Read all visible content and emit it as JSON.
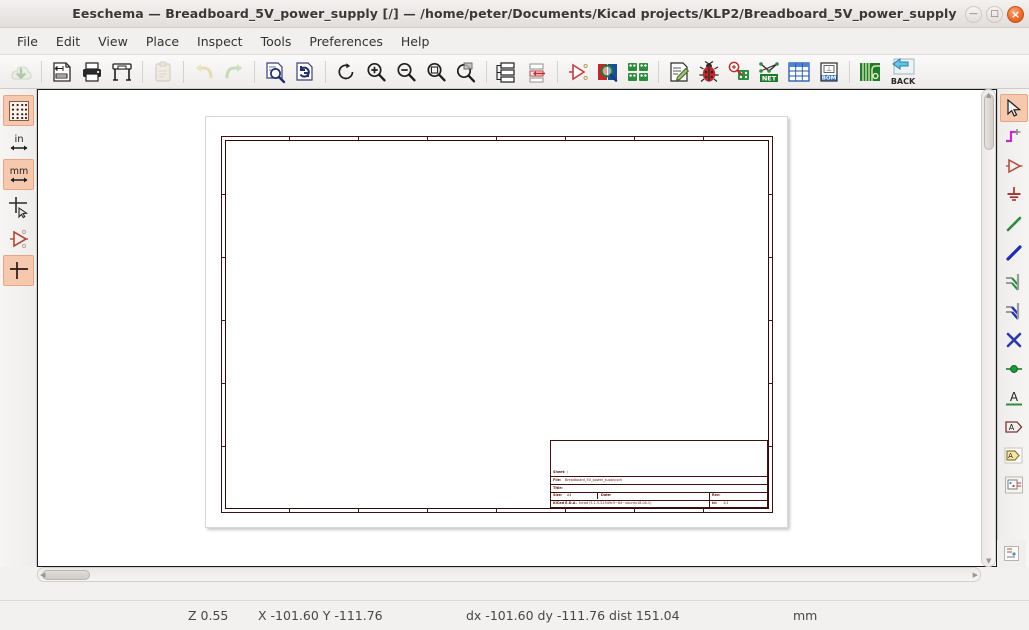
{
  "window": {
    "title": "Eeschema — Breadboard_5V_power_supply [/] — /home/peter/Documents/Kicad projects/KLP2/Breadboard_5V_power_supply",
    "minimize_label": "—",
    "maximize_label": "□",
    "close_label": "×"
  },
  "menubar": {
    "items": [
      {
        "label": "File"
      },
      {
        "label": "Edit"
      },
      {
        "label": "View"
      },
      {
        "label": "Place"
      },
      {
        "label": "Inspect"
      },
      {
        "label": "Tools"
      },
      {
        "label": "Preferences"
      },
      {
        "label": "Help"
      }
    ]
  },
  "toolbar": {
    "items": [
      {
        "name": "save-icon",
        "tip": "Save"
      },
      {
        "name": "page-settings-icon",
        "tip": "Page settings"
      },
      {
        "name": "print-icon",
        "tip": "Print"
      },
      {
        "name": "plot-icon",
        "tip": "Plot"
      },
      {
        "name": "paste-icon",
        "tip": "Paste"
      },
      {
        "name": "undo-icon",
        "tip": "Undo"
      },
      {
        "name": "redo-icon",
        "tip": "Redo"
      },
      {
        "name": "find-icon",
        "tip": "Find"
      },
      {
        "name": "refresh-icon",
        "tip": "Refresh"
      },
      {
        "name": "zoom-redraw-icon",
        "tip": "Redraw view"
      },
      {
        "name": "zoom-in-icon",
        "tip": "Zoom in"
      },
      {
        "name": "zoom-out-icon",
        "tip": "Zoom out"
      },
      {
        "name": "zoom-fit-icon",
        "tip": "Zoom to fit"
      },
      {
        "name": "zoom-area-icon",
        "tip": "Zoom to selection"
      },
      {
        "name": "navigate-hierarchy-icon",
        "tip": "Navigate schematic hierarchy"
      },
      {
        "name": "leave-sheet-icon",
        "tip": "Leave sheet"
      },
      {
        "name": "annotate-icon",
        "tip": "Annotate schematic symbols"
      },
      {
        "name": "symbol-checker-icon",
        "tip": "Symbol checker"
      },
      {
        "name": "symbol-editor-icon",
        "tip": "Symbol editor"
      },
      {
        "name": "erc-icon",
        "tip": "Electrical rules checker"
      },
      {
        "name": "footprint-assign-icon",
        "tip": "Assign footprints"
      },
      {
        "name": "netlist-icon",
        "tip": "Generate netlist"
      },
      {
        "name": "bom-table-icon",
        "tip": "Edit symbol fields"
      },
      {
        "name": "bom-icon",
        "tip": "Generate bill of materials"
      },
      {
        "name": "pcbnew-icon",
        "tip": "Run Pcbnew"
      },
      {
        "name": "back-annotate-icon",
        "tip": "Update schematic from PCB",
        "label": "BACK"
      }
    ]
  },
  "left_toolbar": {
    "items": [
      {
        "name": "toggle-grid-icon",
        "active": true,
        "tip": "Show grid"
      },
      {
        "name": "units-inches-icon",
        "active": false,
        "label": "in",
        "tip": "Set units to inches"
      },
      {
        "name": "units-millimeters-icon",
        "active": true,
        "label": "mm",
        "tip": "Set units to millimeters"
      },
      {
        "name": "cursor-fullscreen-icon",
        "active": false,
        "tip": "Toggle full-window crosshair cursor"
      },
      {
        "name": "hidden-pins-icon",
        "active": false,
        "tip": "Show hidden pins"
      },
      {
        "name": "force-hv-wires-icon",
        "active": true,
        "tip": "Force H/V wires and buses"
      }
    ]
  },
  "right_toolbar": {
    "items": [
      {
        "name": "select-arrow-icon",
        "active": true,
        "tip": "Select item"
      },
      {
        "name": "highlight-net-icon",
        "active": false,
        "tip": "Highlight net"
      },
      {
        "name": "place-symbol-icon",
        "active": false,
        "tip": "Place symbol"
      },
      {
        "name": "place-power-icon",
        "active": false,
        "tip": "Place power port"
      },
      {
        "name": "draw-wire-icon",
        "active": false,
        "tip": "Draw wires"
      },
      {
        "name": "draw-bus-icon",
        "active": false,
        "tip": "Draw buses"
      },
      {
        "name": "wire-to-bus-icon",
        "active": false,
        "tip": "Add wire to bus entry"
      },
      {
        "name": "bus-to-bus-icon",
        "active": false,
        "tip": "Add bus to bus entry"
      },
      {
        "name": "no-connect-icon",
        "active": false,
        "tip": "Add no-connect flag"
      },
      {
        "name": "junction-icon",
        "active": false,
        "tip": "Add junction"
      },
      {
        "name": "net-label-icon",
        "active": false,
        "tip": "Add net label"
      },
      {
        "name": "global-label-icon",
        "active": false,
        "tip": "Add global label"
      },
      {
        "name": "hierarchical-label-icon",
        "active": false,
        "tip": "Add hierarchical label"
      },
      {
        "name": "hierarchical-sheet-icon",
        "active": false,
        "tip": "Add hierarchical sheet"
      }
    ]
  },
  "canvas": {
    "sheet": {
      "page_size": "A4",
      "title_block": {
        "sheet_label": "Sheet:",
        "sheet_path": "/",
        "file_label": "File:",
        "file_value": "Breadboard_5V_power_supply.sch",
        "title_label": "Title:",
        "title_value": "",
        "size_label": "Size:",
        "size_value": "A4",
        "date_label": "Date:",
        "date_value": "",
        "rev_label": "Rev:",
        "rev_value": "",
        "kicad_label": "KiCad E.D.A.",
        "kicad_value": "kicad (5.1.5-52549c5~84~ubuntu18.04.1)",
        "id_label": "Id:",
        "id_value": "1/1"
      }
    }
  },
  "statusbar": {
    "zoom": "Z 0.55",
    "coords": "X -101.60 Y -111.76",
    "delta": "dx -101.60 dy -111.76 dist 151.04",
    "units": "mm"
  },
  "colors": {
    "titlebar_text": "#3b3734",
    "close_button": "#ef6c2e",
    "toolbar_active": "#f6c8ae",
    "schematic_frame": "#40130f",
    "wire_green": "#2e8b40",
    "bus_blue": "#2030b0",
    "label_magenta": "#b824b8",
    "canvas_bg": "#ffffff"
  }
}
